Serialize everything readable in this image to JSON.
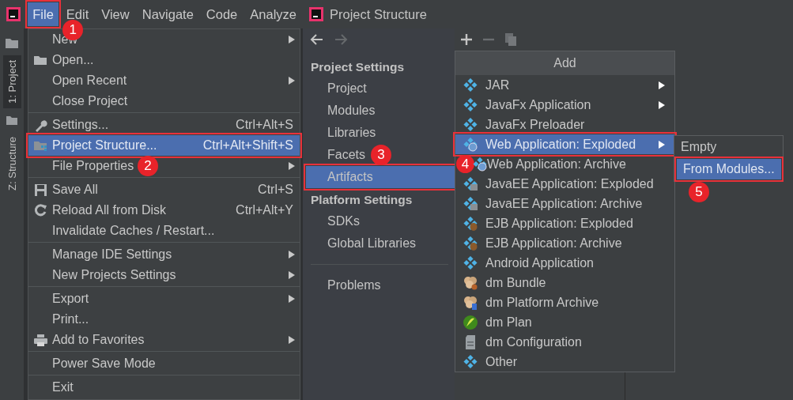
{
  "ide": {
    "menu_bar": [
      {
        "label": "File",
        "selected": true,
        "highlighted": true,
        "callout": "1"
      },
      {
        "label": "Edit",
        "selected": false
      },
      {
        "label": "View",
        "selected": false
      },
      {
        "label": "Navigate",
        "selected": false
      },
      {
        "label": "Code",
        "selected": false
      },
      {
        "label": "Analyze",
        "selected": false
      }
    ],
    "tool_windows": [
      {
        "label": "1: Project",
        "selected": true
      },
      {
        "label": "Z: Structure",
        "selected": false
      }
    ],
    "file_menu": {
      "groups": [
        [
          {
            "label": "New",
            "submenu": true,
            "selected": false
          },
          {
            "label": "Open...",
            "selected": false
          },
          {
            "label": "Open Recent",
            "submenu": true,
            "selected": false
          },
          {
            "label": "Close Project",
            "selected": false
          }
        ],
        [
          {
            "label": "Settings...",
            "shortcut": "Ctrl+Alt+S",
            "selected": false
          },
          {
            "label": "Project Structure...",
            "shortcut": "Ctrl+Alt+Shift+S",
            "selected": true,
            "highlighted": true
          },
          {
            "label": "File Properties",
            "submenu": true,
            "selected": false,
            "callout": "2"
          }
        ],
        [
          {
            "label": "Save All",
            "shortcut": "Ctrl+S",
            "selected": false
          },
          {
            "label": "Reload All from Disk",
            "shortcut": "Ctrl+Alt+Y",
            "selected": false
          },
          {
            "label": "Invalidate Caches / Restart...",
            "selected": false
          }
        ],
        [
          {
            "label": "Manage IDE Settings",
            "submenu": true,
            "selected": false
          },
          {
            "label": "New Projects Settings",
            "submenu": true,
            "selected": false
          }
        ],
        [
          {
            "label": "Export",
            "submenu": true,
            "selected": false
          },
          {
            "label": "Print...",
            "selected": false
          },
          {
            "label": "Add to Favorites",
            "submenu": true,
            "selected": false
          }
        ],
        [
          {
            "label": "Power Save Mode",
            "selected": false
          }
        ],
        [
          {
            "label": "Exit",
            "selected": false
          }
        ]
      ]
    }
  },
  "project_structure": {
    "title": "Project Structure",
    "nav": {
      "forward_disabled": true
    },
    "sidebar": {
      "sections": [
        {
          "title": "Project Settings",
          "items": [
            {
              "label": "Project",
              "selected": false
            },
            {
              "label": "Modules",
              "selected": false
            },
            {
              "label": "Libraries",
              "selected": false
            },
            {
              "label": "Facets",
              "selected": false,
              "callout": "3"
            },
            {
              "label": "Artifacts",
              "selected": true,
              "highlighted": true
            }
          ]
        },
        {
          "title": "Platform Settings",
          "items": [
            {
              "label": "SDKs",
              "selected": false
            },
            {
              "label": "Global Libraries",
              "selected": false
            }
          ]
        },
        {
          "items": [
            {
              "label": "Problems",
              "selected": false
            }
          ]
        }
      ]
    },
    "add_menu": {
      "title": "Add",
      "items": [
        {
          "label": "JAR",
          "submenu": true,
          "selected": false
        },
        {
          "label": "JavaFx Application",
          "submenu": true,
          "selected": false
        },
        {
          "label": "JavaFx Preloader",
          "selected": false
        },
        {
          "label": "Web Application: Exploded",
          "submenu": true,
          "selected": true,
          "highlighted": true
        },
        {
          "label": "Web Application: Archive",
          "selected": false,
          "callout": "4"
        },
        {
          "label": "JavaEE Application: Exploded",
          "selected": false
        },
        {
          "label": "JavaEE Application: Archive",
          "selected": false
        },
        {
          "label": "EJB Application: Exploded",
          "selected": false
        },
        {
          "label": "EJB Application: Archive",
          "selected": false
        },
        {
          "label": "Android Application",
          "selected": false
        },
        {
          "label": "dm Bundle",
          "selected": false
        },
        {
          "label": "dm Platform Archive",
          "selected": false
        },
        {
          "label": "dm Plan",
          "selected": false
        },
        {
          "label": "dm Configuration",
          "selected": false
        },
        {
          "label": "Other",
          "selected": false
        }
      ]
    },
    "submenu": {
      "items": [
        {
          "label": "Empty",
          "selected": false
        },
        {
          "label": "From Modules...",
          "selected": true,
          "highlighted": true,
          "callout": "5"
        }
      ]
    }
  }
}
